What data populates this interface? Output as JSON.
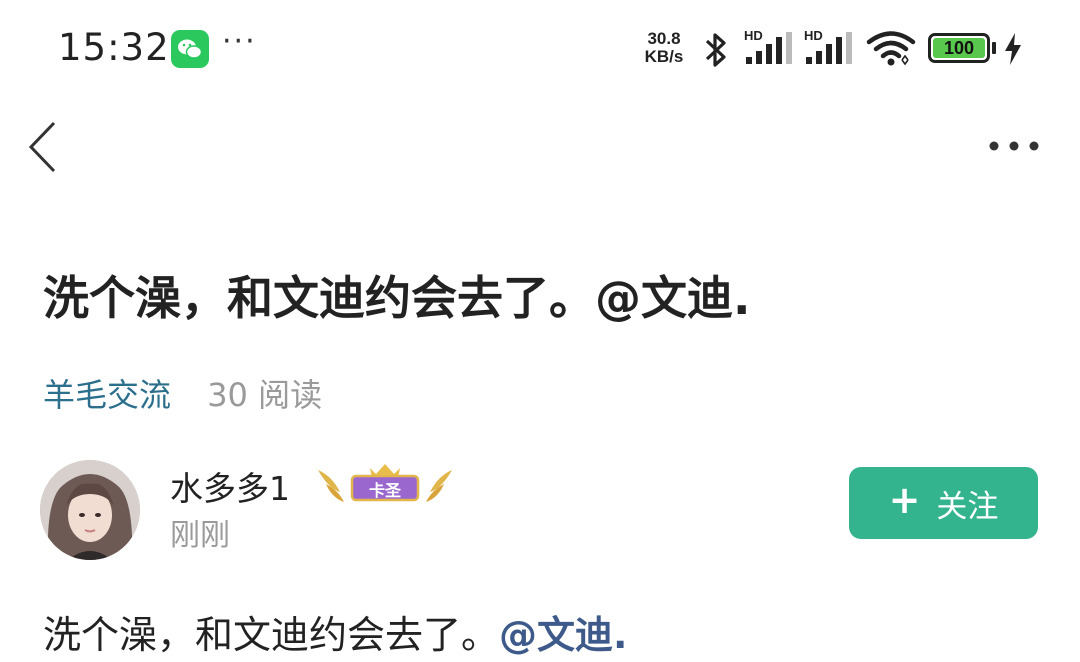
{
  "status_bar": {
    "time": "15:32",
    "app_icon": "wechat-icon",
    "more": "···",
    "net_speed_value": "30.8",
    "net_speed_unit": "KB/s",
    "network_label_1": "HD",
    "network_label_2": "HD",
    "battery_level": "100",
    "icons": [
      "bluetooth-icon",
      "signal-icon",
      "signal-icon",
      "wifi-icon",
      "battery-icon",
      "charging-icon"
    ],
    "colors": {
      "wechat": "#2bc85e",
      "battery": "#59c64d"
    }
  },
  "nav": {
    "back_icon": "chevron-left-icon",
    "menu_icon": "more-horizontal-icon"
  },
  "post": {
    "title": "洗个澡，和文迪约会去了。@文迪.",
    "category": "羊毛交流",
    "reads": "30 阅读",
    "author": {
      "name": "水多多1",
      "badge": "卡圣",
      "time": "刚刚"
    },
    "follow_label": "关注",
    "follow_plus": "+",
    "body_text": "洗个澡，和文迪约会去了。",
    "mention": "@文迪.",
    "colors": {
      "follow_button": "#33b48f",
      "category": "#2c6f8c",
      "mention": "#3d5a8a"
    }
  }
}
